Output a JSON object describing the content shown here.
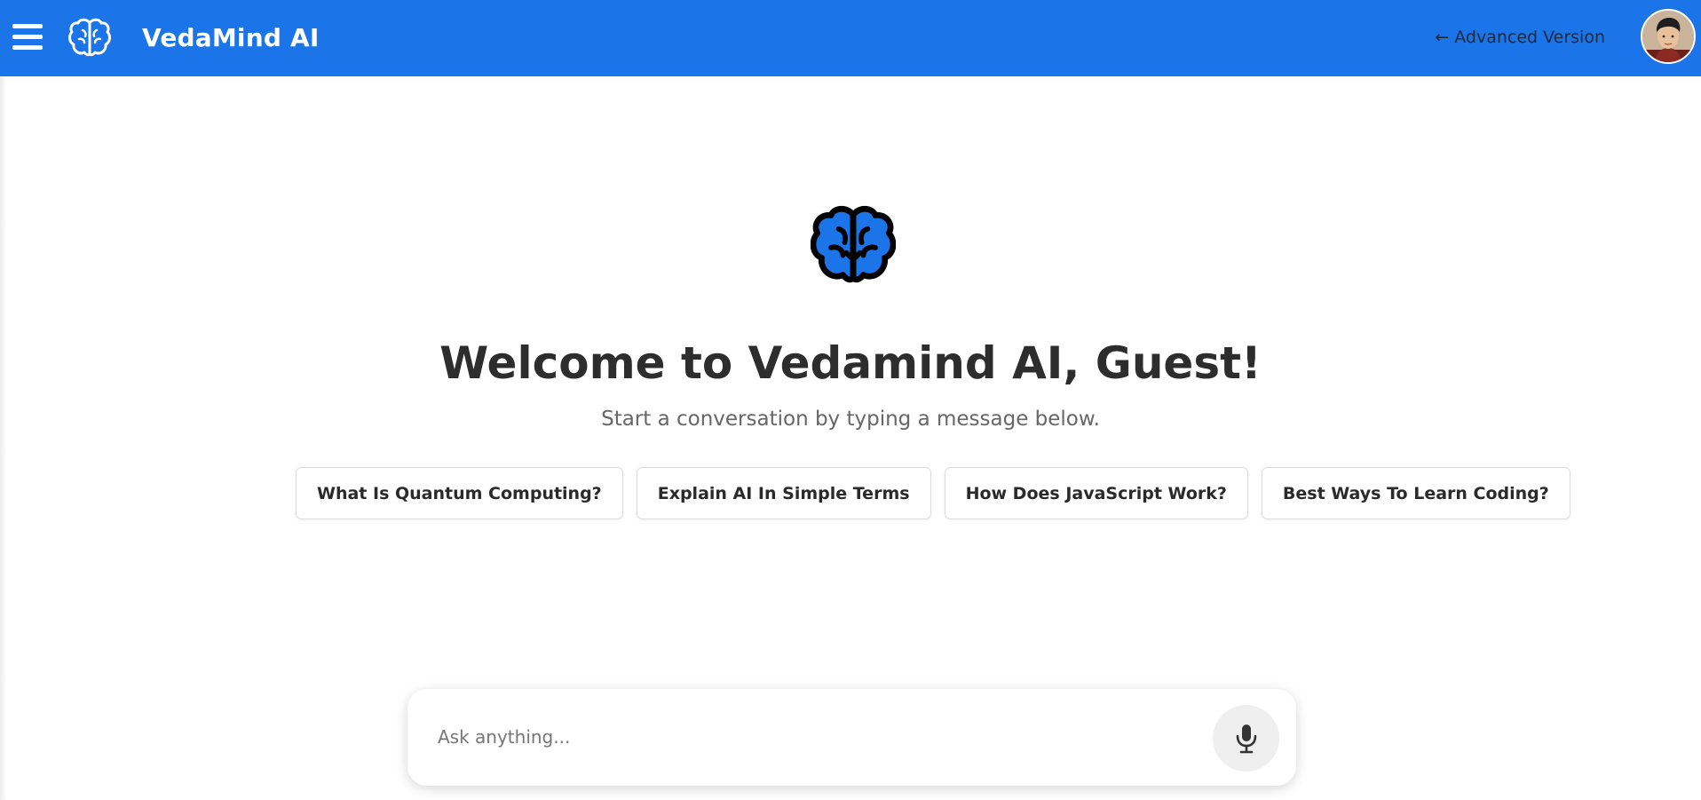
{
  "header": {
    "app_title": "VedaMind AI",
    "advanced_link": "← Advanced Version",
    "brand_color": "#1c74e9"
  },
  "icons": {
    "menu": "hamburger-menu-icon",
    "logo": "brain-icon",
    "hero": "brain-icon",
    "mic": "microphone-icon"
  },
  "main": {
    "welcome": "Welcome to Vedamind AI, Guest!",
    "subtitle": "Start a conversation by typing a message below.",
    "suggestions": [
      "What Is Quantum Computing?",
      "Explain AI In Simple Terms",
      "How Does JavaScript Work?",
      "Best Ways To Learn Coding?"
    ]
  },
  "composer": {
    "placeholder": "Ask anything...",
    "value": ""
  }
}
